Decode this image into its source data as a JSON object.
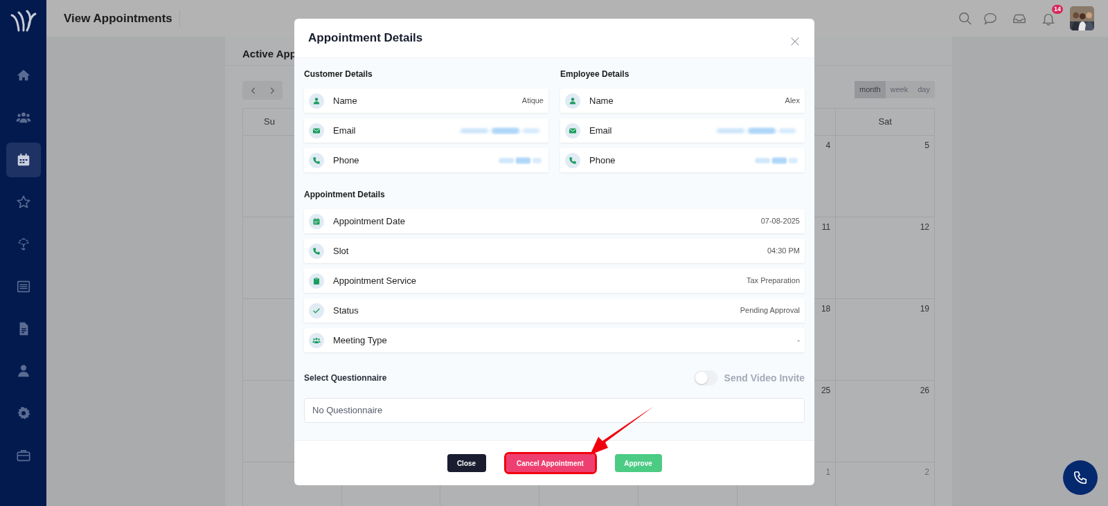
{
  "sidebar": {
    "items": [
      {
        "selected": false
      },
      {
        "selected": false
      },
      {
        "selected": true
      },
      {
        "selected": false
      },
      {
        "selected": false
      },
      {
        "selected": false
      },
      {
        "selected": false
      },
      {
        "selected": false
      },
      {
        "selected": false
      },
      {
        "selected": false
      }
    ]
  },
  "header": {
    "title": "View Appointments",
    "notification_count": "14"
  },
  "calendar": {
    "title": "Active App",
    "view_buttons": [
      {
        "label": "month",
        "selected": true
      },
      {
        "label": "week",
        "selected": false
      },
      {
        "label": "day",
        "selected": false
      }
    ],
    "first_day_header": "Su",
    "last_day_header": "Sat",
    "weeks": [
      {
        "fri": "4",
        "sat": "5",
        "outside_month": false
      },
      {
        "fri": "11",
        "sat": "12",
        "outside_month": false
      },
      {
        "fri": "18",
        "sat": "19",
        "outside_month": false
      },
      {
        "fri": "25",
        "sat": "26",
        "outside_month": false
      },
      {
        "fri": "1",
        "sat": "2",
        "outside_month": true
      }
    ]
  },
  "modal": {
    "title": "Appointment Details",
    "customer": {
      "heading": "Customer Details",
      "fields": [
        {
          "label": "Name",
          "value": "Atique",
          "redacted": false
        },
        {
          "label": "Email",
          "redacted": true
        },
        {
          "label": "Phone",
          "redacted": true
        }
      ]
    },
    "employee": {
      "heading": "Employee Details",
      "fields": [
        {
          "label": "Name",
          "value": "Alex",
          "redacted": false
        },
        {
          "label": "Email",
          "redacted": true
        },
        {
          "label": "Phone",
          "redacted": true
        }
      ]
    },
    "appointment": {
      "heading": "Appointment Details",
      "fields": [
        {
          "label": "Appointment Date",
          "value": "07-08-2025",
          "redacted": false
        },
        {
          "label": "Slot",
          "value": "04:30 PM",
          "redacted": false
        },
        {
          "label": "Appointment Service",
          "value": "Tax Preparation",
          "redacted": false
        },
        {
          "label": "Status",
          "value": "Pending Approval",
          "redacted": false
        },
        {
          "label": "Meeting Type",
          "value": "-",
          "redacted": false
        }
      ]
    },
    "questionnaire": {
      "label": "Select Questionnaire",
      "value": "No Questionnaire"
    },
    "video_invite": {
      "label": "Send Video Invite",
      "on": false
    },
    "buttons": [
      {
        "label": "Close",
        "kind": "dark",
        "highlighted": false
      },
      {
        "label": "Cancel Appointment",
        "kind": "danger",
        "highlighted": true
      },
      {
        "label": "Approve",
        "kind": "success",
        "highlighted": false
      }
    ]
  }
}
